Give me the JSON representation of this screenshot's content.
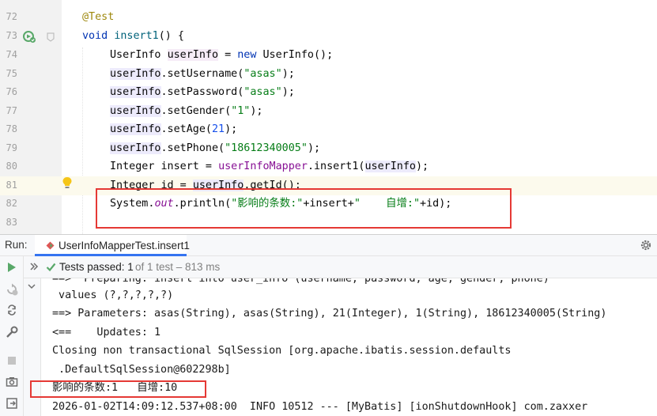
{
  "editor": {
    "lines": [
      {
        "num": "72"
      },
      {
        "num": "73"
      },
      {
        "num": "74"
      },
      {
        "num": "75"
      },
      {
        "num": "76"
      },
      {
        "num": "77"
      },
      {
        "num": "78"
      },
      {
        "num": "79"
      },
      {
        "num": "80"
      },
      {
        "num": "81"
      },
      {
        "num": "82"
      },
      {
        "num": "83"
      }
    ],
    "annotation": "@Test",
    "kw_void": "void",
    "method_name": "insert1",
    "method_tail": "() {",
    "l74": {
      "type": "UserInfo",
      "sp": " ",
      "var": "userInfo",
      "eq": " = ",
      "kw_new": "new",
      "rest": " UserInfo();"
    },
    "l75": {
      "obj": "userInfo",
      "call": ".setUsername(",
      "arg": "\"asas\"",
      "end": ");"
    },
    "l76": {
      "obj": "userInfo",
      "call": ".setPassword(",
      "arg": "\"asas\"",
      "end": ");"
    },
    "l77": {
      "obj": "userInfo",
      "call": ".setGender(",
      "arg": "\"1\"",
      "end": ");"
    },
    "l78": {
      "obj": "userInfo",
      "call": ".setAge(",
      "arg": "21",
      "end": ");"
    },
    "l79": {
      "obj": "userInfo",
      "call": ".setPhone(",
      "arg": "\"18612340005\"",
      "end": ");"
    },
    "l80": {
      "pre": "Integer insert = ",
      "field": "userInfoMapper",
      "mid": ".insert1(",
      "arg": "userInfo",
      "end": ");"
    },
    "l81": {
      "pre": "Integer id = ",
      "obj": "userInfo",
      "end": ".getId();"
    },
    "l82": {
      "pre": "System.",
      "out": "out",
      "mid": ".println(",
      "s1": "\"影响的条数:\"",
      "mid2": "+insert+",
      "s2": "\"    自增:\"",
      "end": "+id);"
    }
  },
  "run_panel": {
    "label": "Run:",
    "tab_label": "UserInfoMapperTest.insert1",
    "expand_glyph": "»",
    "tests_passed": "Tests passed: 1",
    "tests_detail": "of 1 test – 813 ms",
    "console_lines": [
      "==>  Preparing: insert into user_info (username, password, age, gender, phone)",
      " values (?,?,?,?,?)",
      "==> Parameters: asas(String), asas(String), 21(Integer), 1(String), 18612340005(String)",
      "<==    Updates: 1",
      "Closing non transactional SqlSession [org.apache.ibatis.session.defaults",
      " .DefaultSqlSession@602298b]",
      "影响的条数:1   自增:10",
      "2026-01-02T14:09:12.537+08:00  INFO 10512 --- [MyBatis] [ionShutdownHook] com.zaxxer"
    ]
  },
  "colors": {
    "keyword": "#0033b3",
    "string": "#067d17",
    "number": "#1750eb",
    "field": "#871094",
    "annotation": "#9e880d",
    "highlight_box": "#e53935",
    "pass_green": "#59a869"
  }
}
